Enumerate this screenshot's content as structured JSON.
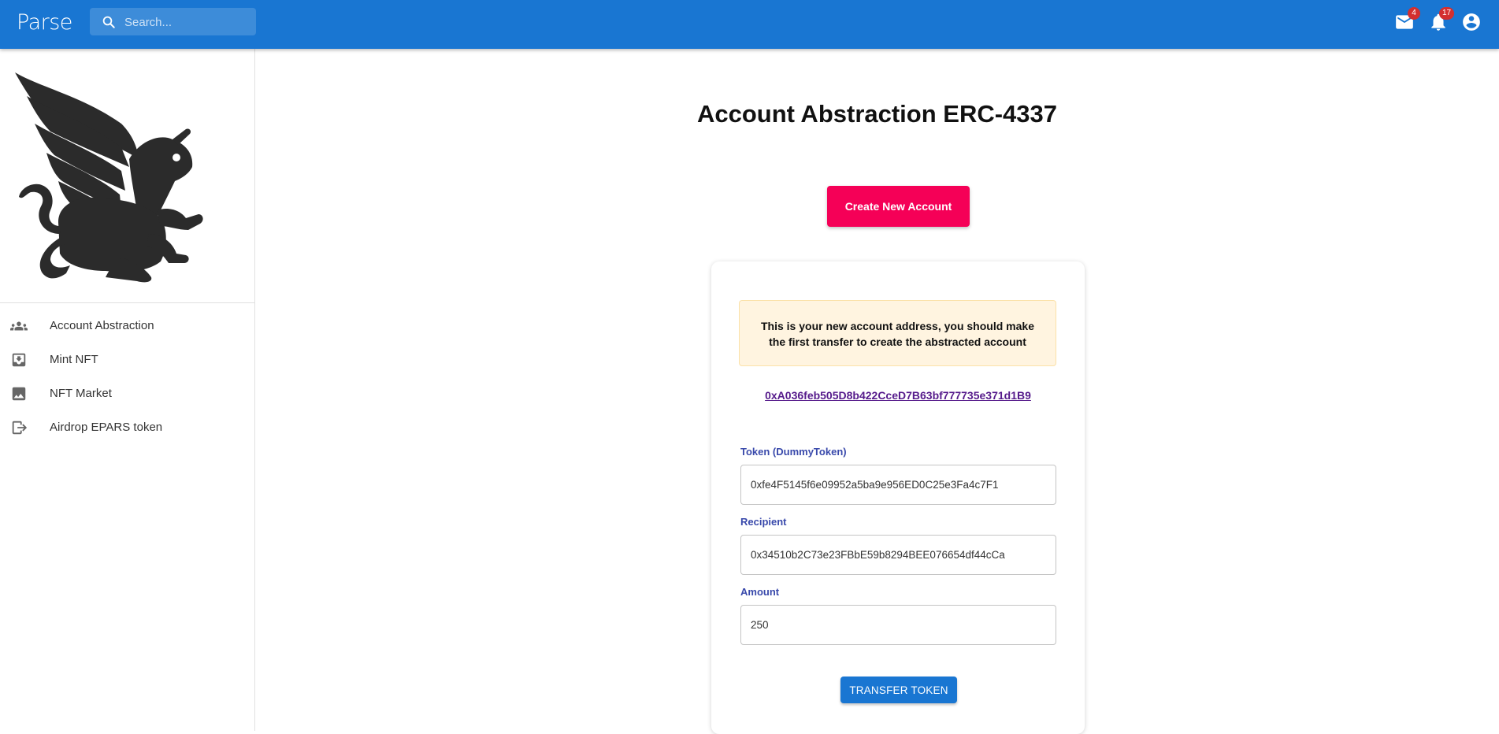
{
  "app": {
    "brand": "Parse"
  },
  "search": {
    "placeholder": "Search..."
  },
  "header": {
    "mail_badge": "4",
    "notifications_badge": "17"
  },
  "sidebar": {
    "logo_icon": "griffin-logo",
    "items": [
      {
        "label": "Account Abstraction",
        "icon": "people-icon"
      },
      {
        "label": "Mint NFT",
        "icon": "inbox-icon"
      },
      {
        "label": "NFT Market",
        "icon": "image-icon"
      },
      {
        "label": "Airdrop EPARS token",
        "icon": "exit-icon"
      }
    ]
  },
  "main": {
    "title": "Account Abstraction ERC-4337",
    "create_button": "Create New Account",
    "alert": "This is your new account address, you should make the first transfer to create the abstracted account",
    "account_address": "0xA036feb505D8b422CceD7B63bf777735e371d1B9",
    "form": {
      "token_label": "Token (DummyToken)",
      "token_value": "0xfe4F5145f6e09952a5ba9e956ED0C25e3Fa4c7F1",
      "recipient_label": "Recipient",
      "recipient_value": "0x34510b2C73e23FBbE59b8294BEE076654df44cCa",
      "amount_label": "Amount",
      "amount_value": "250",
      "submit_label": "TRANSFER TOKEN"
    }
  },
  "colors": {
    "appbar": "#1976d2",
    "create_button": "#f50057",
    "alert_background": "#fff4e0",
    "field_label": "#3949ab",
    "badge": "#d32f2f"
  }
}
